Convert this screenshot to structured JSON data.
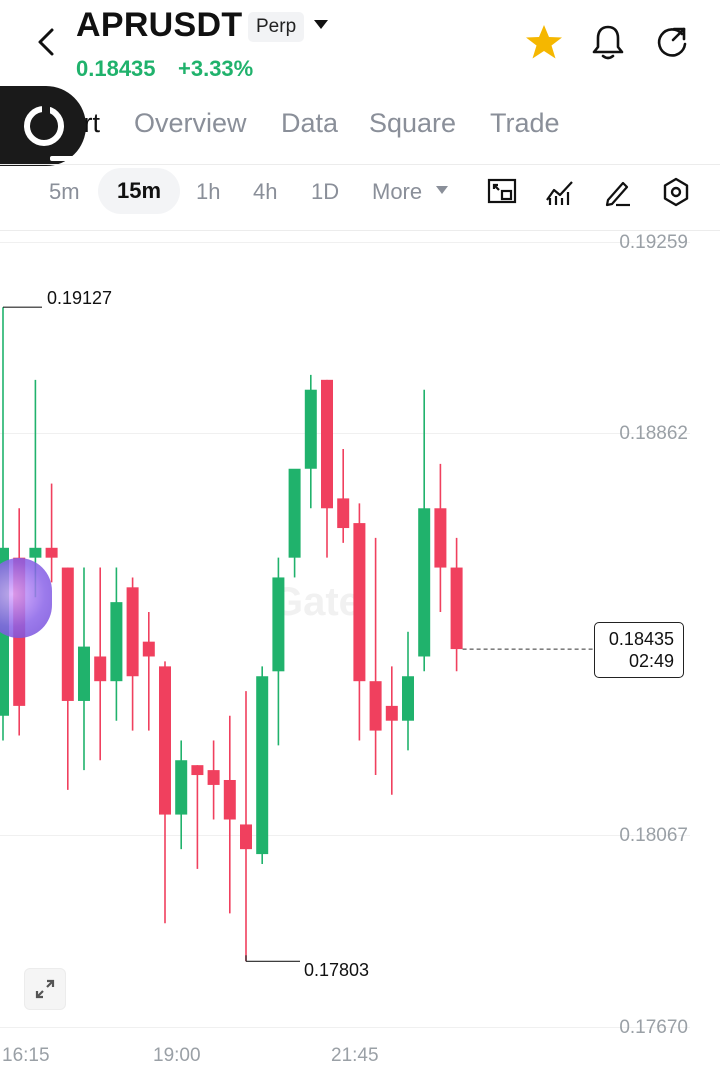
{
  "header": {
    "symbol": "APRUSDT",
    "contract_badge": "Perp",
    "last_price": "0.18435",
    "change_pct": "+3.33%",
    "icons": [
      "back-arrow-icon",
      "chevron-down-icon",
      "star-icon",
      "bell-icon",
      "share-icon"
    ]
  },
  "tabs": [
    "Chart",
    "Overview",
    "Data",
    "Square",
    "Trade"
  ],
  "active_tab": "Chart",
  "intervals": [
    "5m",
    "15m",
    "1h",
    "4h",
    "1D",
    "More"
  ],
  "active_interval": "15m",
  "toolbar_icons": [
    "chart-type-icon",
    "indicator-icon",
    "draw-pen-icon",
    "settings-hex-icon"
  ],
  "colors": {
    "up": "#20b26c",
    "down": "#f0405e",
    "accent_star": "#f5b700"
  },
  "chart_data": {
    "type": "candlestick",
    "y_axis_labels": [
      "0.19259",
      "0.18862",
      "0.18067",
      "0.17670"
    ],
    "x_axis_labels": [
      "16:15",
      "19:00",
      "21:45"
    ],
    "high_annotation": "0.19127",
    "low_annotation": "0.17803",
    "current_price": "0.18435",
    "countdown": "02:49",
    "watermark": "Gate",
    "candles": [
      {
        "o": 0.183,
        "h": 0.19127,
        "l": 0.1825,
        "c": 0.1864
      },
      {
        "o": 0.1862,
        "h": 0.1872,
        "l": 0.1826,
        "c": 0.1832
      },
      {
        "o": 0.1862,
        "h": 0.1898,
        "l": 0.1854,
        "c": 0.1864
      },
      {
        "o": 0.1864,
        "h": 0.1877,
        "l": 0.1857,
        "c": 0.1862
      },
      {
        "o": 0.186,
        "h": 0.186,
        "l": 0.1815,
        "c": 0.1833
      },
      {
        "o": 0.1833,
        "h": 0.186,
        "l": 0.1819,
        "c": 0.1844
      },
      {
        "o": 0.1842,
        "h": 0.186,
        "l": 0.1821,
        "c": 0.1837
      },
      {
        "o": 0.1837,
        "h": 0.186,
        "l": 0.1829,
        "c": 0.1853
      },
      {
        "o": 0.1856,
        "h": 0.1858,
        "l": 0.1827,
        "c": 0.1838
      },
      {
        "o": 0.1845,
        "h": 0.1851,
        "l": 0.1827,
        "c": 0.1842
      },
      {
        "o": 0.184,
        "h": 0.1841,
        "l": 0.1788,
        "c": 0.181
      },
      {
        "o": 0.181,
        "h": 0.1825,
        "l": 0.1803,
        "c": 0.1821
      },
      {
        "o": 0.182,
        "h": 0.182,
        "l": 0.1799,
        "c": 0.1818
      },
      {
        "o": 0.1819,
        "h": 0.1825,
        "l": 0.1809,
        "c": 0.1816
      },
      {
        "o": 0.1817,
        "h": 0.183,
        "l": 0.179,
        "c": 0.1809
      },
      {
        "o": 0.1808,
        "h": 0.1835,
        "l": 0.17803,
        "c": 0.1803
      },
      {
        "o": 0.1802,
        "h": 0.184,
        "l": 0.18,
        "c": 0.1838
      },
      {
        "o": 0.1839,
        "h": 0.1862,
        "l": 0.1824,
        "c": 0.1858
      },
      {
        "o": 0.1862,
        "h": 0.1878,
        "l": 0.1858,
        "c": 0.188
      },
      {
        "o": 0.188,
        "h": 0.1899,
        "l": 0.1872,
        "c": 0.1896
      },
      {
        "o": 0.1898,
        "h": 0.1898,
        "l": 0.1862,
        "c": 0.1872
      },
      {
        "o": 0.1874,
        "h": 0.1884,
        "l": 0.1865,
        "c": 0.1868
      },
      {
        "o": 0.1869,
        "h": 0.1873,
        "l": 0.1825,
        "c": 0.1837
      },
      {
        "o": 0.1837,
        "h": 0.1866,
        "l": 0.1818,
        "c": 0.1827
      },
      {
        "o": 0.1832,
        "h": 0.184,
        "l": 0.1814,
        "c": 0.1829
      },
      {
        "o": 0.1829,
        "h": 0.1847,
        "l": 0.1823,
        "c": 0.1838
      },
      {
        "o": 0.1842,
        "h": 0.1896,
        "l": 0.1839,
        "c": 0.1872
      },
      {
        "o": 0.1872,
        "h": 0.1881,
        "l": 0.1851,
        "c": 0.186
      },
      {
        "o": 0.186,
        "h": 0.1866,
        "l": 0.1839,
        "c": 0.18435
      }
    ]
  }
}
